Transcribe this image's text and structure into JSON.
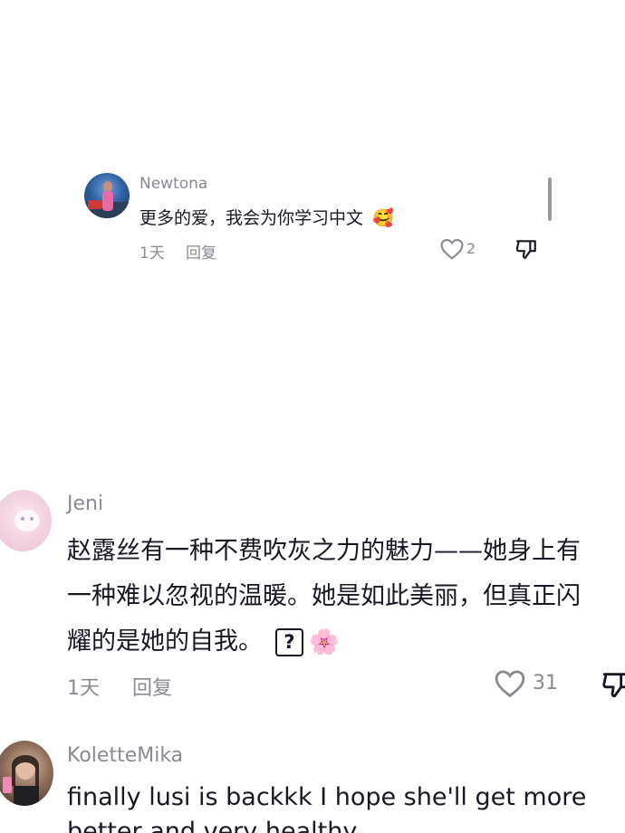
{
  "comments": [
    {
      "username": "Newtona",
      "text": "更多的爱，我会为你学习中文",
      "emoji": "🥰",
      "time": "1天",
      "reply_label": "回复",
      "likes": "2"
    },
    {
      "username": "Jeni",
      "text": "赵露丝有一种不费吹灰之力的魅力——她身上有\n一种难以忽视的温暖。她是如此美丽，但真正闪\n耀的是她的自我。",
      "unknown_glyph": "?",
      "emoji": "🌸",
      "time": "1天",
      "reply_label": "回复",
      "likes": "31"
    },
    {
      "username": "KoletteMika",
      "text_line1": "finally lusi is backkk I hope she'll get more",
      "text_line2": "better and very healthy"
    }
  ],
  "colors": {
    "text_primary": "#161823",
    "text_secondary": "#8a8b91"
  }
}
